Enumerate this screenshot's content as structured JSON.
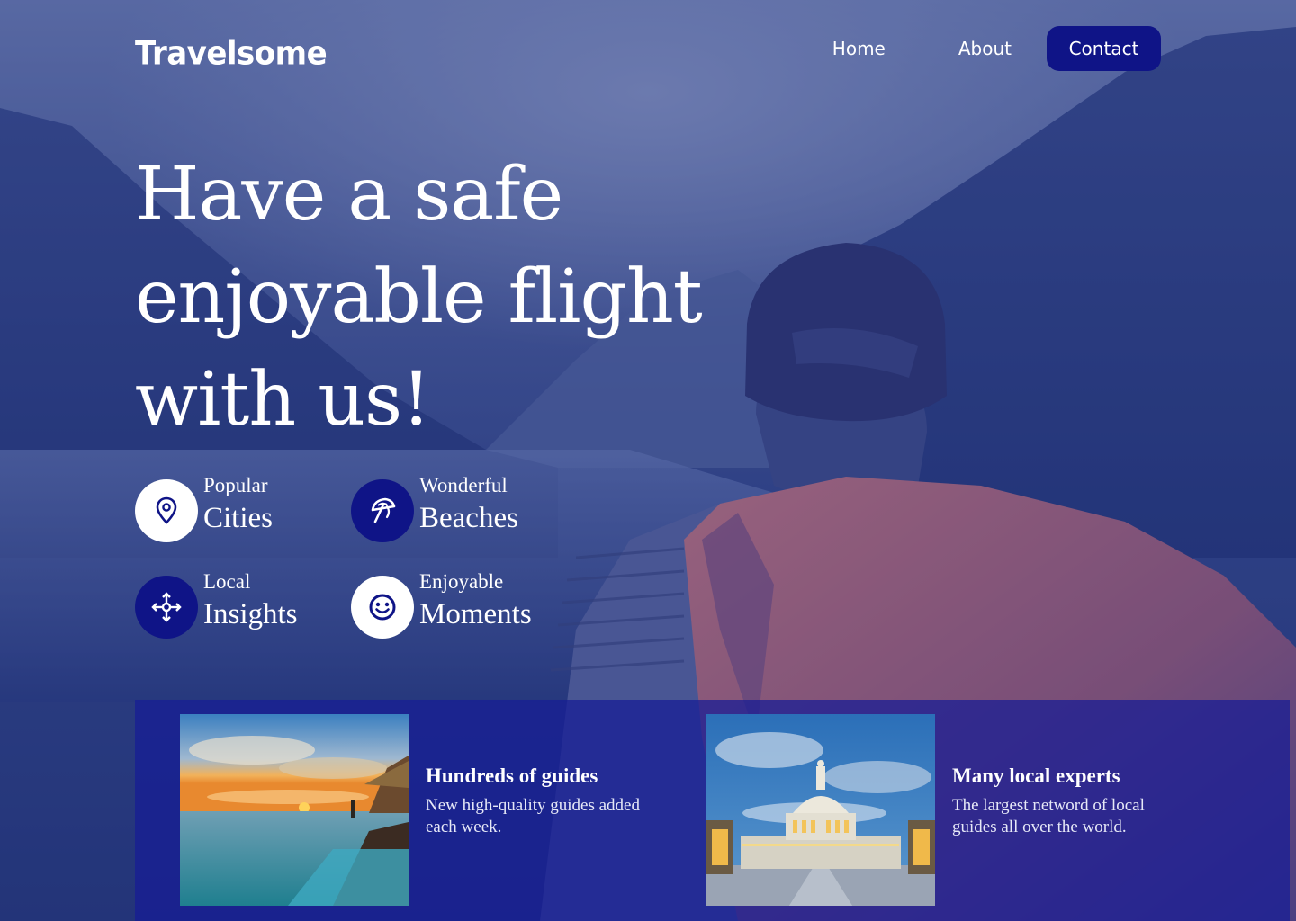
{
  "brand": {
    "logo": "Travelsome"
  },
  "nav": {
    "items": [
      {
        "label": "Home"
      },
      {
        "label": "About"
      },
      {
        "label": "Contact"
      }
    ]
  },
  "hero": {
    "lines": [
      "Have a safe",
      "enjoyable flight",
      "with us!"
    ]
  },
  "features": [
    {
      "small": "Popular",
      "big": "Cities",
      "icon": "map-pin-icon",
      "style": "light"
    },
    {
      "small": "Wonderful",
      "big": "Beaches",
      "icon": "umbrella-icon",
      "style": "dark"
    },
    {
      "small": "Local",
      "big": "Insights",
      "icon": "compass-arrows-icon",
      "style": "dark"
    },
    {
      "small": "Enjoyable",
      "big": "Moments",
      "icon": "smiley-icon",
      "style": "light"
    }
  ],
  "cards": [
    {
      "title": "Hundreds of guides",
      "description": "New high-quality guides added each week.",
      "image": "sunset-beach-villa"
    },
    {
      "title": "Many local experts",
      "description": "The largest netword of local guides all over the world.",
      "image": "capitol-building"
    }
  ],
  "colors": {
    "accent": "#0f1487",
    "panel": "#161c96",
    "text": "#ffffff"
  }
}
